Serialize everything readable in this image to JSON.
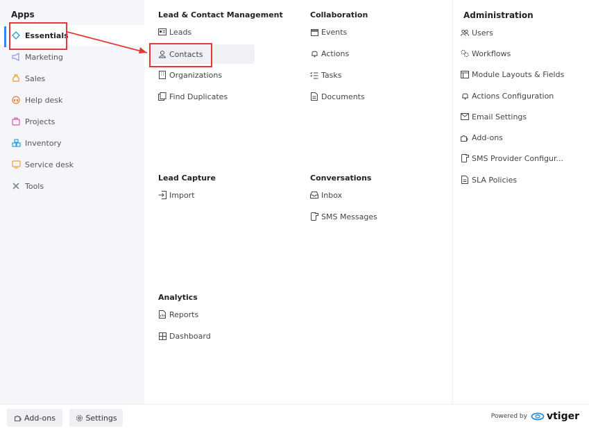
{
  "apps": {
    "title": "Apps",
    "items": [
      {
        "label": "Essentials",
        "icon": "diamond-icon"
      },
      {
        "label": "Marketing",
        "icon": "megaphone-icon"
      },
      {
        "label": "Sales",
        "icon": "moneybag-icon"
      },
      {
        "label": "Help desk",
        "icon": "headset-icon"
      },
      {
        "label": "Projects",
        "icon": "briefcase-icon"
      },
      {
        "label": "Inventory",
        "icon": "boxes-icon"
      },
      {
        "label": "Service desk",
        "icon": "monitor-icon"
      },
      {
        "label": "Tools",
        "icon": "tools-icon"
      }
    ]
  },
  "lead_contact": {
    "title": "Lead & Contact Management",
    "items": [
      "Leads",
      "Contacts",
      "Organizations",
      "Find Duplicates"
    ]
  },
  "collaboration": {
    "title": "Collaboration",
    "items": [
      "Events",
      "Actions",
      "Tasks",
      "Documents"
    ]
  },
  "lead_capture": {
    "title": "Lead Capture",
    "items": [
      "Import"
    ]
  },
  "conversations": {
    "title": "Conversations",
    "items": [
      "Inbox",
      "SMS Messages"
    ]
  },
  "analytics": {
    "title": "Analytics",
    "items": [
      "Reports",
      "Dashboard"
    ]
  },
  "administration": {
    "title": "Administration",
    "items": [
      "Users",
      "Workflows",
      "Module Layouts & Fields",
      "Actions Configuration",
      "Email Settings",
      "Add-ons",
      "SMS Provider Configur...",
      "SLA Policies"
    ]
  },
  "footer": {
    "addons_label": "Add-ons",
    "settings_label": "Settings",
    "powered_by": "Powered by",
    "brand": "vtiger"
  },
  "colors": {
    "accent": "#3b82f6",
    "annotation": "#e23a3a"
  }
}
